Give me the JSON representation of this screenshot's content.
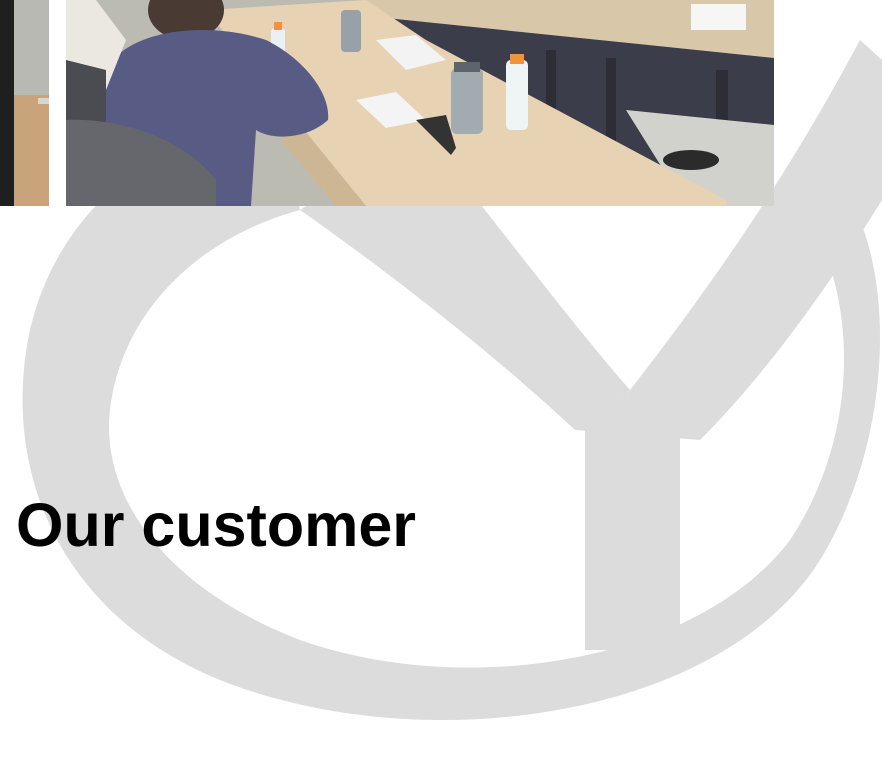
{
  "heading": "Our customer",
  "colors": {
    "background": "#ffffff",
    "watermark": "#dcdcdc",
    "heading_text": "#000000"
  },
  "watermark": {
    "icon": "company-logo-watermark"
  },
  "photos": [
    {
      "name": "meeting-photo-left-crop"
    },
    {
      "name": "meeting-room-photo"
    }
  ]
}
